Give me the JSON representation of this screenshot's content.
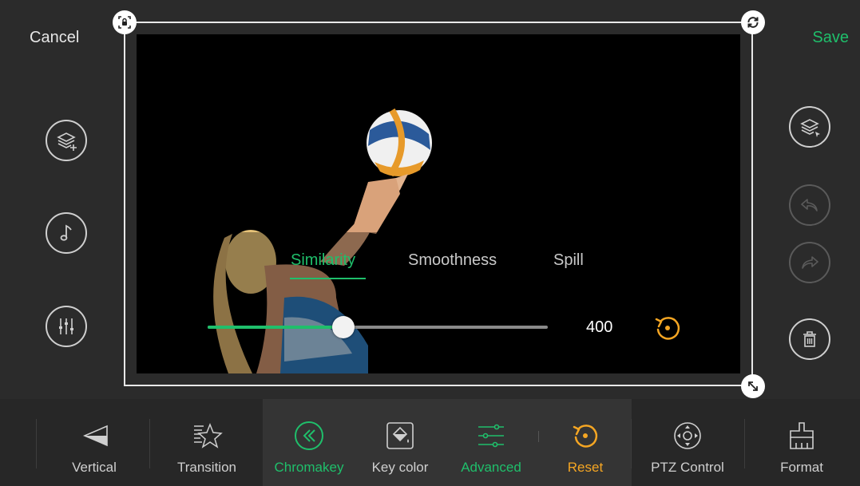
{
  "header": {
    "cancel_label": "Cancel",
    "save_label": "Save"
  },
  "chromakey": {
    "tabs": [
      {
        "label": "Similarity",
        "active": true
      },
      {
        "label": "Smoothness",
        "active": false
      },
      {
        "label": "Spill",
        "active": false
      }
    ],
    "slider_level_fraction": 0.4,
    "value_label": "400"
  },
  "left_tools": [
    {
      "name": "add-layer",
      "icon": "layers-plus-icon"
    },
    {
      "name": "music",
      "icon": "music-note-icon"
    },
    {
      "name": "audio-mixer",
      "icon": "mixer-icon"
    }
  ],
  "right_tools": [
    {
      "name": "select-layer",
      "icon": "layers-cursor-icon",
      "enabled": true
    },
    {
      "name": "undo",
      "icon": "undo-icon",
      "enabled": false
    },
    {
      "name": "redo",
      "icon": "redo-icon",
      "enabled": false
    },
    {
      "name": "delete",
      "icon": "trash-icon",
      "enabled": true
    }
  ],
  "toolbar": {
    "vertical_label": "Vertical",
    "transition_label": "Transition",
    "chromakey_label": "Chromakey",
    "keycolor_label": "Key color",
    "advanced_label": "Advanced",
    "reset_label": "Reset",
    "ptz_label": "PTZ Control",
    "format_label": "Format"
  },
  "colors": {
    "accent": "#1fbf6b",
    "reset": "#f5a623",
    "background": "#2b2b2b"
  }
}
